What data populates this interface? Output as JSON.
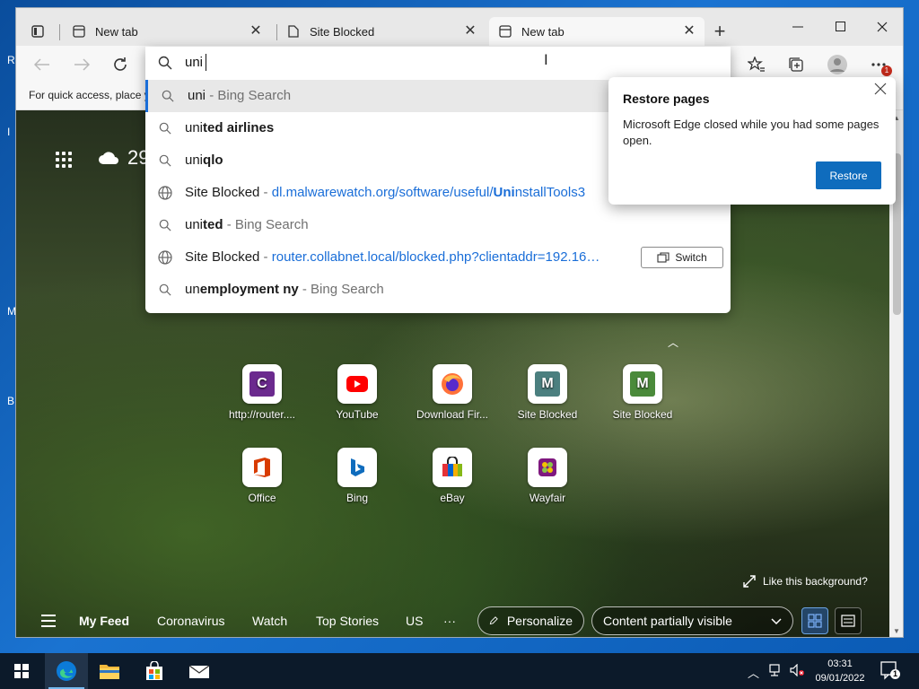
{
  "tabs": [
    {
      "label": "New tab",
      "active": false
    },
    {
      "label": "Site Blocked",
      "active": false
    },
    {
      "label": "New tab",
      "active": true
    }
  ],
  "favorites_bar": {
    "text": "For quick access, place y"
  },
  "omnibox": {
    "query": "uni",
    "suggestions": [
      {
        "type": "search",
        "prefix": "uni",
        "bold": "",
        "suffix": " - Bing Search",
        "selected": true
      },
      {
        "type": "search",
        "prefix": "uni",
        "bold": "ted airlines",
        "suffix": "",
        "selected": false
      },
      {
        "type": "search",
        "prefix": "uni",
        "bold": "qlo",
        "suffix": "",
        "selected": false
      },
      {
        "type": "site",
        "title": "Site Blocked",
        "sep": " - ",
        "url_pre": "dl.malwarewatch.org/software/useful/",
        "url_bold": "Uni",
        "url_post": "nstallTools3"
      },
      {
        "type": "search",
        "prefix": "uni",
        "bold": "ted",
        "suffix": " - Bing Search",
        "selected": false
      },
      {
        "type": "site",
        "title": "Site Blocked",
        "sep": " - ",
        "url_pre": "router.collabnet.local/blocked.php?clientaddr=192.16…",
        "url_bold": "",
        "url_post": "",
        "switch_label": "Switch"
      },
      {
        "type": "search",
        "prefix": "un",
        "bold": "employment ny",
        "suffix": " - Bing Search",
        "selected": false
      }
    ]
  },
  "restore_popup": {
    "title": "Restore pages",
    "message": "Microsoft Edge closed while you had some pages open.",
    "button": "Restore"
  },
  "ntp": {
    "weather_temp": "29",
    "tiles_row1": [
      {
        "label": "http://router....",
        "letter": "C",
        "color": "#7b2a8e",
        "icon": "c-icon"
      },
      {
        "label": "YouTube",
        "letter": "",
        "color": "#ff0000",
        "icon": "youtube-icon"
      },
      {
        "label": "Download Fir...",
        "letter": "",
        "color": "#ff7139",
        "icon": "firefox-icon"
      },
      {
        "label": "Site Blocked",
        "letter": "M",
        "color": "#4b7f7f",
        "icon": "m-icon"
      },
      {
        "label": "Site Blocked",
        "letter": "M",
        "color": "#4a8a3a",
        "icon": "m-icon"
      }
    ],
    "tiles_row2": [
      {
        "label": "Office",
        "icon": "office-icon",
        "color": "#d83b01"
      },
      {
        "label": "Bing",
        "icon": "bing-icon",
        "color": "#0f6cbd"
      },
      {
        "label": "eBay",
        "icon": "ebay-icon",
        "color": "#e53238"
      },
      {
        "label": "Wayfair",
        "icon": "wayfair-icon",
        "color": "#7f187f"
      }
    ],
    "like_background": "Like this background?"
  },
  "feed": {
    "my_feed": "My Feed",
    "items": [
      "Coronavirus",
      "Watch",
      "Top Stories",
      "US"
    ],
    "more": "···",
    "personalize": "Personalize",
    "content_visibility": "Content partially visible"
  },
  "taskbar": {
    "time": "03:31",
    "date": "09/01/2022",
    "notification_count": "1"
  },
  "menu_badge": "1",
  "colors": {
    "accent": "#0f6cbd",
    "link": "#1a6ed8"
  }
}
